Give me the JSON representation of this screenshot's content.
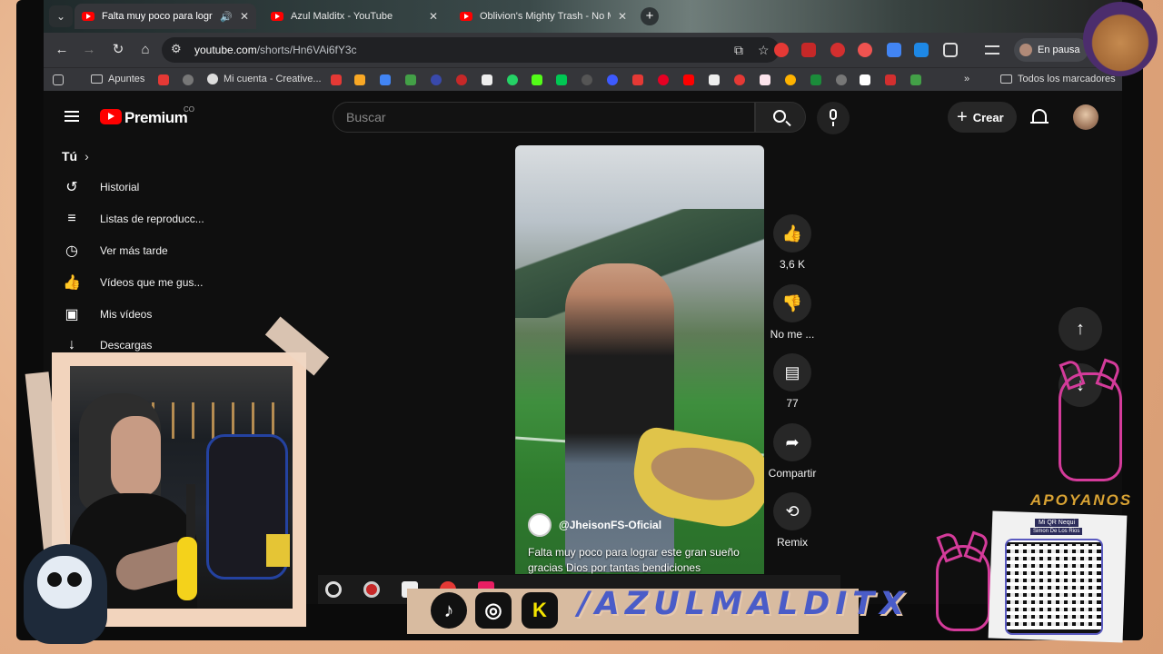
{
  "browser": {
    "tabs": [
      {
        "title": "Falta muy poco para lograr",
        "active": true,
        "playing_audio": true
      },
      {
        "title": "Azul Malditx - YouTube",
        "active": false
      },
      {
        "title": "Oblivion's Mighty Trash - No M",
        "active": false
      }
    ],
    "url_domain": "youtube.com",
    "url_path": "/shorts/Hn6VAi6fY3c",
    "profile_status": "En pausa",
    "bookmarks": [
      "Apuntes",
      "Mi cuenta - Creative...",
      "Todos los marcadores"
    ],
    "bookmarks_overflow": "»"
  },
  "youtube": {
    "brand": "Premium",
    "brand_country": "CO",
    "search_placeholder": "Buscar",
    "create_label": "Crear",
    "sidebar": {
      "you_header": "Tú",
      "items": [
        {
          "label": "Historial",
          "icon": "history-icon"
        },
        {
          "label": "Listas de reproducc...",
          "icon": "playlist-icon"
        },
        {
          "label": "Ver más tarde",
          "icon": "clock-icon"
        },
        {
          "label": "Vídeos que me gus...",
          "icon": "thumbs-up-icon"
        },
        {
          "label": "Mis vídeos",
          "icon": "play-square-icon"
        },
        {
          "label": "Descargas",
          "icon": "download-icon"
        }
      ]
    },
    "short": {
      "channel": "@JheisonFS-Oficial",
      "caption": "Falta muy poco para lograr este gran sueño gracias Dios por tantas bendiciones"
    },
    "actions": {
      "likes": "3,6 K",
      "dislike_label": "No me ...",
      "comments": "77",
      "share_label": "Compartir",
      "remix_label": "Remix"
    }
  },
  "overlay": {
    "handle": "/AZULMALDITX",
    "support_label": "APOYANOS",
    "qr_title": "Mi QR Nequi",
    "qr_sub": "Simon De Los Rios",
    "social": [
      "tiktok",
      "instagram",
      "kick"
    ]
  },
  "colors": {
    "yt_red": "#ff0000",
    "handle_blue": "#4a5cc8",
    "frame_paper": "#e8b895",
    "devil_pink": "#d43b9a"
  }
}
